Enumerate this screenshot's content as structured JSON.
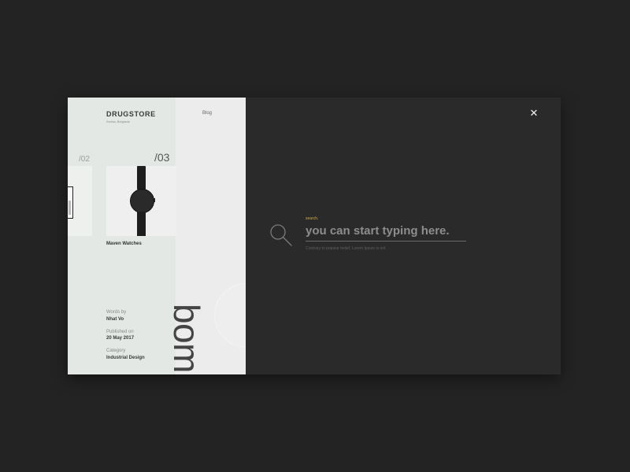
{
  "card": {
    "brand": {
      "title": "DRUGSTORE",
      "subtitle": "Serbia, Belgrade"
    },
    "nav": {
      "blog_label": "Blog"
    },
    "slider": {
      "prev_index": "/02",
      "current_index": "/03",
      "current_caption": "Maven Watches"
    },
    "vertical_word": "bombette.",
    "meta": {
      "words_label": "Words by",
      "words_value": "Nhat Vo",
      "published_label": "Published on",
      "published_value": "20 May 2017",
      "category_label": "Category",
      "category_value": "Industrial Design"
    }
  },
  "search": {
    "kicker": "search.",
    "placeholder": "you can start typing here.",
    "hint": "Contrary to popular belief, Lorem Ipsum is not",
    "close_icon": "close-icon",
    "icon": "search-icon"
  },
  "colors": {
    "page_background": "#232323",
    "card_background": "#e3e8e4",
    "panel_background": "#2a2a2a",
    "accent": "#d2a94b"
  }
}
